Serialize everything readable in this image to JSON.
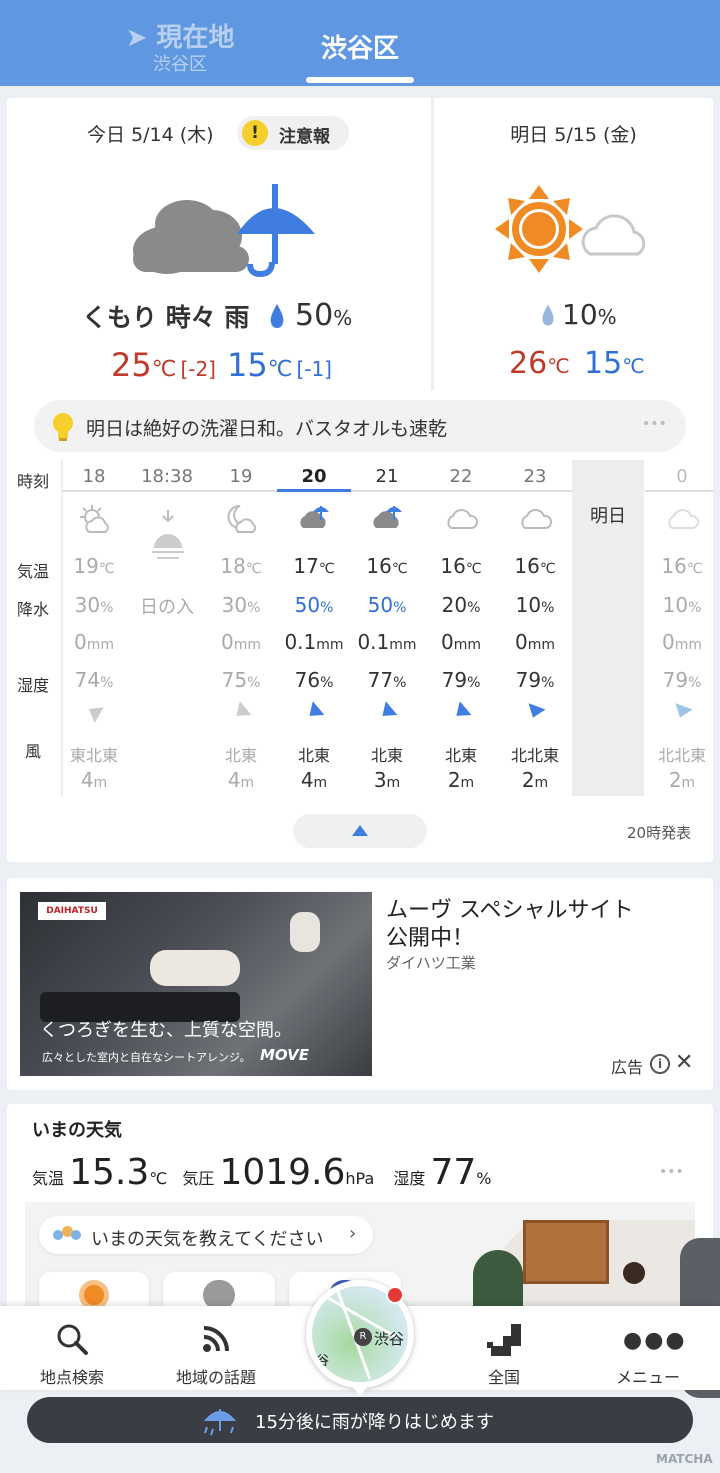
{
  "header": {
    "current_location_label": "現在地",
    "current_location_sub": "渋谷区",
    "selected_tab": "渋谷区"
  },
  "today": {
    "date": "今日 5/14 (木)",
    "alert": "注意報",
    "weather": "くもり 時々 雨",
    "precip": "50",
    "precip_unit": "%",
    "high": "25",
    "high_diff": "[-2]",
    "low": "15",
    "low_diff": "[-1]",
    "temp_unit": "℃"
  },
  "tomorrow": {
    "date": "明日 5/15 (金)",
    "precip": "10",
    "precip_unit": "%",
    "high": "26",
    "low": "15",
    "temp_unit": "℃"
  },
  "tip": {
    "text": "明日は絶好の洗濯日和。バスタオルも速乾",
    "more": "•••"
  },
  "hourly": {
    "row_labels": {
      "time": "時刻",
      "temp": "気温",
      "precip": "降水",
      "humidity": "湿度",
      "wind": "風"
    },
    "tomorrow_label": "明日",
    "published": "20時発表",
    "hours": [
      {
        "h": "18",
        "temp": "19",
        "unit": "℃",
        "pop": "30",
        "pop_unit": "%",
        "rain": "0",
        "rain_unit": "mm",
        "hum": "74",
        "hum_unit": "%",
        "wind_dir": "東北東",
        "wind_speed": "4",
        "wind_unit": "m",
        "icon": "partly-cloudy-sun-icon"
      },
      {
        "h": "18:38",
        "sunset": "日の入",
        "icon": "sunset-icon"
      },
      {
        "h": "19",
        "temp": "18",
        "unit": "℃",
        "pop": "30",
        "pop_unit": "%",
        "rain": "0",
        "rain_unit": "mm",
        "hum": "75",
        "hum_unit": "%",
        "wind_dir": "北東",
        "wind_speed": "4",
        "wind_unit": "m",
        "icon": "moon-cloud-icon"
      },
      {
        "h": "20",
        "temp": "17",
        "unit": "℃",
        "pop": "50",
        "pop_unit": "%",
        "rain": "0.1",
        "rain_unit": "mm",
        "hum": "76",
        "hum_unit": "%",
        "wind_dir": "北東",
        "wind_speed": "4",
        "wind_unit": "m",
        "icon": "cloud-umbrella-icon"
      },
      {
        "h": "21",
        "temp": "16",
        "unit": "℃",
        "pop": "50",
        "pop_unit": "%",
        "rain": "0.1",
        "rain_unit": "mm",
        "hum": "77",
        "hum_unit": "%",
        "wind_dir": "北東",
        "wind_speed": "3",
        "wind_unit": "m",
        "icon": "cloud-umbrella-icon"
      },
      {
        "h": "22",
        "temp": "16",
        "unit": "℃",
        "pop": "20",
        "pop_unit": "%",
        "rain": "0",
        "rain_unit": "mm",
        "hum": "79",
        "hum_unit": "%",
        "wind_dir": "北東",
        "wind_speed": "2",
        "wind_unit": "m",
        "icon": "cloud-icon"
      },
      {
        "h": "23",
        "temp": "16",
        "unit": "℃",
        "pop": "10",
        "pop_unit": "%",
        "rain": "0",
        "rain_unit": "mm",
        "hum": "79",
        "hum_unit": "%",
        "wind_dir": "北北東",
        "wind_speed": "2",
        "wind_unit": "m",
        "icon": "cloud-icon"
      },
      {
        "h": "0",
        "temp": "16",
        "unit": "℃",
        "pop": "10",
        "pop_unit": "%",
        "rain": "0",
        "rain_unit": "mm",
        "hum": "79",
        "hum_unit": "%",
        "wind_dir": "北北東",
        "wind_speed": "2",
        "wind_unit": "m",
        "icon": "cloud-icon"
      }
    ]
  },
  "ad": {
    "title_line1": "ムーヴ スペシャルサイト",
    "title_line2": "公開中！",
    "advertiser": "ダイハツ工業",
    "label": "広告",
    "img_brand": "DAIHATSU",
    "img_copy": "くつろぎを生む、上質な空間。",
    "img_sub": "広々とした室内と自在なシートアレンジ。",
    "img_model": "MOVE"
  },
  "now": {
    "title": "いまの天気",
    "temp_label": "気温",
    "temp": "15.3",
    "temp_unit": "℃",
    "pressure_label": "気圧",
    "pressure": "1019.6",
    "pressure_unit": "hPa",
    "humidity_label": "湿度",
    "humidity": "77",
    "humidity_unit": "%",
    "report_prompt": "いまの天気を教えてください",
    "more": "•••"
  },
  "nav": {
    "search": "地点検索",
    "topics": "地域の話題",
    "map_label": "渋谷",
    "map_label2": "谷",
    "national": "全国",
    "menu": "メニュー"
  },
  "toast": {
    "text": "15分後に雨が降りはじめます"
  },
  "watermark": "MATCHA",
  "colors": {
    "header": "#5f97e0",
    "rain_blue": "#3f7de0",
    "high_red": "#c0392b",
    "low_blue": "#2f6fd6",
    "sun_orange": "#f08a24",
    "alert_yellow": "#f5cf2b"
  }
}
